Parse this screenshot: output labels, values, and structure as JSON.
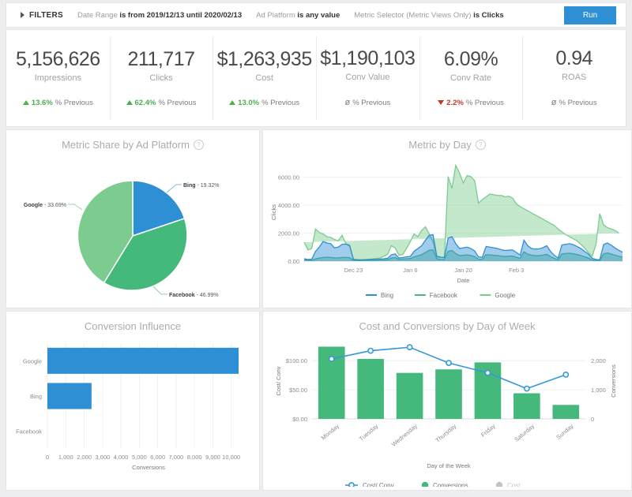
{
  "filters": {
    "toggle_label": "FILTERS",
    "caret_icon": "caret-right-icon",
    "items": [
      {
        "name": "Date Range",
        "value": "is from 2019/12/13 until 2020/02/13"
      },
      {
        "name": "Ad Platform",
        "value": "is any value"
      },
      {
        "name": "Metric Selector (Metric Views Only)",
        "value": "is Clicks"
      }
    ],
    "run_label": "Run",
    "run_color": "#2f8fd4"
  },
  "kpis": [
    {
      "value": "5,156,626",
      "label": "Impressions",
      "direction": "up",
      "delta": "13.6%",
      "suffix": "% Previous"
    },
    {
      "value": "211,717",
      "label": "Clicks",
      "direction": "up",
      "delta": "62.4%",
      "suffix": "% Previous"
    },
    {
      "value": "$1,263,935",
      "label": "Cost",
      "direction": "up",
      "delta": "13.0%",
      "suffix": "% Previous"
    },
    {
      "value": "$1,190,103",
      "label": "Conv Value",
      "direction": "none",
      "delta": "ø",
      "suffix": "% Previous"
    },
    {
      "value": "6.09%",
      "label": "Conv Rate",
      "direction": "down",
      "delta": "2.2%",
      "suffix": "% Previous"
    },
    {
      "value": "0.94",
      "label": "ROAS",
      "direction": "none",
      "delta": "ø",
      "suffix": "% Previous"
    }
  ],
  "colors": {
    "bing": "#2f8fd4",
    "facebook": "#45b97c",
    "google": "#7ccb8f",
    "bar_blue": "#2f8fd4",
    "bar_green": "#45b97c",
    "line_blue": "#3498db",
    "cost_grey": "#c3c6c9"
  },
  "chart_data": [
    {
      "type": "pie",
      "title": "Metric Share by Ad Platform",
      "info_icon": "info-icon",
      "labels": [
        "Bing",
        "Facebook",
        "Google"
      ],
      "values": [
        19.32,
        46.99,
        33.69
      ],
      "value_suffix": "%",
      "annotations": [
        "Bing - 19.32%",
        "Facebook - 46.99%",
        "Google - 33.69%"
      ],
      "colors": [
        "#2f8fd4",
        "#45b97c",
        "#7ccb8f"
      ],
      "legend": "labels-outside"
    },
    {
      "type": "area",
      "title": "Metric by Day",
      "info_icon": "info-icon",
      "xlabel": "Date",
      "ylabel": "Clicks",
      "xticks": [
        "Dec 23",
        "Jan 6",
        "Jan 20",
        "Feb 3"
      ],
      "yticks": [
        "0.00",
        "2000.00",
        "4000.00",
        "6000.00"
      ],
      "ylim": [
        0,
        7000
      ],
      "grid": true,
      "legend": "bottom",
      "series": [
        {
          "name": "Bing",
          "color": "#2f8fd4",
          "values": [
            170,
            120,
            130,
            700,
            1000,
            1400,
            1300,
            1250,
            950,
            1000,
            1200,
            1220,
            1100,
            120,
            90,
            80,
            90,
            110,
            130,
            140,
            150,
            170,
            200,
            450,
            520,
            230,
            260,
            310,
            330,
            700,
            900,
            1100,
            1500,
            1850,
            1900,
            350,
            280,
            260,
            1650,
            1750,
            1250,
            900,
            950,
            1000,
            900,
            720,
            300,
            280,
            1050,
            1000,
            950,
            900,
            820,
            760,
            780,
            800,
            620,
            430,
            1500,
            1100,
            900,
            860,
            880,
            960,
            1100,
            700,
            420,
            220,
            1150,
            1200,
            1250,
            1180,
            1050,
            900,
            700,
            500,
            200,
            120,
            100,
            1180,
            1300,
            1150,
            950,
            780,
            640
          ]
        },
        {
          "name": "Facebook",
          "color": "#45b97c",
          "values": [
            90,
            70,
            60,
            160,
            220,
            260,
            280,
            260,
            240,
            230,
            260,
            270,
            240,
            60,
            50,
            45,
            50,
            55,
            60,
            65,
            70,
            80,
            95,
            220,
            260,
            130,
            150,
            170,
            180,
            300,
            380,
            460,
            620,
            780,
            800,
            160,
            130,
            120,
            700,
            760,
            540,
            400,
            420,
            440,
            400,
            320,
            140,
            130,
            460,
            440,
            420,
            400,
            360,
            340,
            350,
            360,
            280,
            200,
            660,
            500,
            420,
            390,
            400,
            430,
            490,
            320,
            190,
            100,
            520,
            540,
            560,
            530,
            470,
            400,
            310,
            220,
            90,
            55,
            45,
            520,
            580,
            510,
            420,
            350,
            290
          ]
        },
        {
          "name": "Google",
          "color": "#7ccb8f",
          "values": [
            1350,
            800,
            900,
            2300,
            2050,
            1950,
            1750,
            1700,
            1550,
            1450,
            1850,
            1250,
            1150,
            150,
            120,
            110,
            120,
            130,
            150,
            180,
            220,
            350,
            480,
            1100,
            950,
            430,
            470,
            900,
            1400,
            1950,
            1750,
            2200,
            2450,
            1950,
            1350,
            300,
            260,
            250,
            6050,
            5200,
            6850,
            6300,
            5600,
            6120,
            6050,
            5750,
            4150,
            4400,
            4600,
            4800,
            4750,
            4700,
            4700,
            4600,
            4650,
            4500,
            4100,
            3900,
            3750,
            3600,
            3450,
            3300,
            3150,
            3000,
            2850,
            2700,
            2550,
            2300,
            2100,
            1900,
            1750,
            1600,
            1450,
            1200,
            950,
            600,
            350,
            1200,
            3400,
            2600,
            2400,
            2300,
            2200,
            2000
          ]
        }
      ]
    },
    {
      "type": "bar",
      "orientation": "horizontal",
      "title": "Conversion Influence",
      "categories": [
        "Google",
        "Bing",
        "Facebook"
      ],
      "values": [
        10400,
        2400,
        0
      ],
      "xlabel": "Conversions",
      "ylabel": "",
      "xticks": [
        "0",
        "1,000",
        "2,000",
        "3,000",
        "4,000",
        "5,000",
        "6,000",
        "7,000",
        "8,000",
        "9,000",
        "10,000"
      ],
      "xlim": [
        0,
        11000
      ],
      "color": "#2f8fd4",
      "grid": true
    },
    {
      "type": "combo",
      "title": "Cost and Conversions by Day of Week",
      "categories": [
        "Monday",
        "Tuesday",
        "Wednesday",
        "Thursday",
        "Friday",
        "Saturday",
        "Sunday"
      ],
      "xlabel": "Day of the Week",
      "left_axis": {
        "label": "Cost/ Conv",
        "ticks": [
          "$0.00",
          "$50.00",
          "$100.00"
        ],
        "lim": [
          0,
          130
        ]
      },
      "right_axis": {
        "label": "Conversions",
        "ticks": [
          "0",
          "1,000",
          "2,000"
        ],
        "lim": [
          0,
          2600
        ]
      },
      "series": [
        {
          "name": "Conversions",
          "type": "bar",
          "color": "#45b97c",
          "axis": "right",
          "values": [
            2480,
            2060,
            1580,
            1700,
            1940,
            880,
            480
          ]
        },
        {
          "name": "Cost/ Conv",
          "type": "line",
          "color": "#3498db",
          "axis": "left",
          "values": [
            103,
            117,
            123,
            96,
            79,
            52,
            76
          ]
        },
        {
          "name": "Cost",
          "type": "hidden",
          "color": "#c3c6c9",
          "values": []
        }
      ],
      "legend": [
        "Cost/ Conv",
        "Conversions",
        "Cost"
      ],
      "legend_position": "bottom"
    }
  ]
}
